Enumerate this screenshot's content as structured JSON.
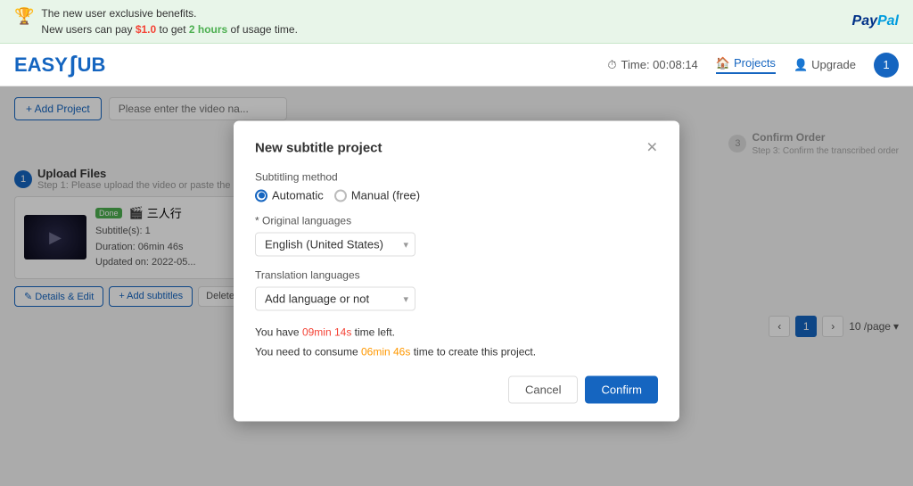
{
  "banner": {
    "text_line1": "The new user exclusive benefits.",
    "text_line2_prefix": "New users can pay ",
    "text_line2_price": "$1.0",
    "text_line2_middle": " to get ",
    "text_line2_hours": "2 hours",
    "text_line2_suffix": " of usage time.",
    "paypal_text1": "Pay",
    "paypal_text2": "Pal"
  },
  "header": {
    "logo_text": "EASY",
    "logo_sub": "SUB",
    "time_label": "Time: 00:08:14",
    "projects_label": "Projects",
    "upgrade_label": "Upgrade",
    "avatar_label": "1"
  },
  "toolbar": {
    "add_project_label": "+ Add Project",
    "search_placeholder": "Please enter the video na..."
  },
  "steps": {
    "confirm_order_num": "3",
    "confirm_order_label": "Confirm Order",
    "confirm_order_sub": "Step 3: Confirm the transcribed order"
  },
  "upload": {
    "step_num": "1",
    "title": "Upload Files",
    "subtitle": "Step 1: Please upload the video or paste the URL.",
    "file": {
      "done_badge": "Done",
      "file_icon": "🎬",
      "title": "三人行",
      "subtitles": "Subtitle(s): 1",
      "duration": "Duration: 06min 46s",
      "updated": "Updated on: 2022-05..."
    },
    "details_btn": "✎ Details & Edit",
    "add_subtitles_btn": "+ Add subtitles",
    "delete_btn": "Delete"
  },
  "pagination": {
    "prev_icon": "‹",
    "page": "1",
    "next_icon": "›",
    "per_page": "10 /page"
  },
  "modal": {
    "title": "New subtitle project",
    "close_icon": "✕",
    "subtitling_method_label": "Subtitling method",
    "automatic_label": "Automatic",
    "manual_label": "Manual (free)",
    "original_language_label": "* Original languages",
    "original_language_value": "English (United States)",
    "translation_language_label": "Translation languages",
    "translation_placeholder": "Add language or not",
    "time_left_line1_prefix": "You have ",
    "time_left_value": "09min 14s",
    "time_left_suffix": " time left.",
    "consume_line2_prefix": "You need to consume ",
    "consume_value": "06min 46s",
    "consume_suffix": " time to create this project.",
    "cancel_label": "Cancel",
    "confirm_label": "Confirm"
  }
}
